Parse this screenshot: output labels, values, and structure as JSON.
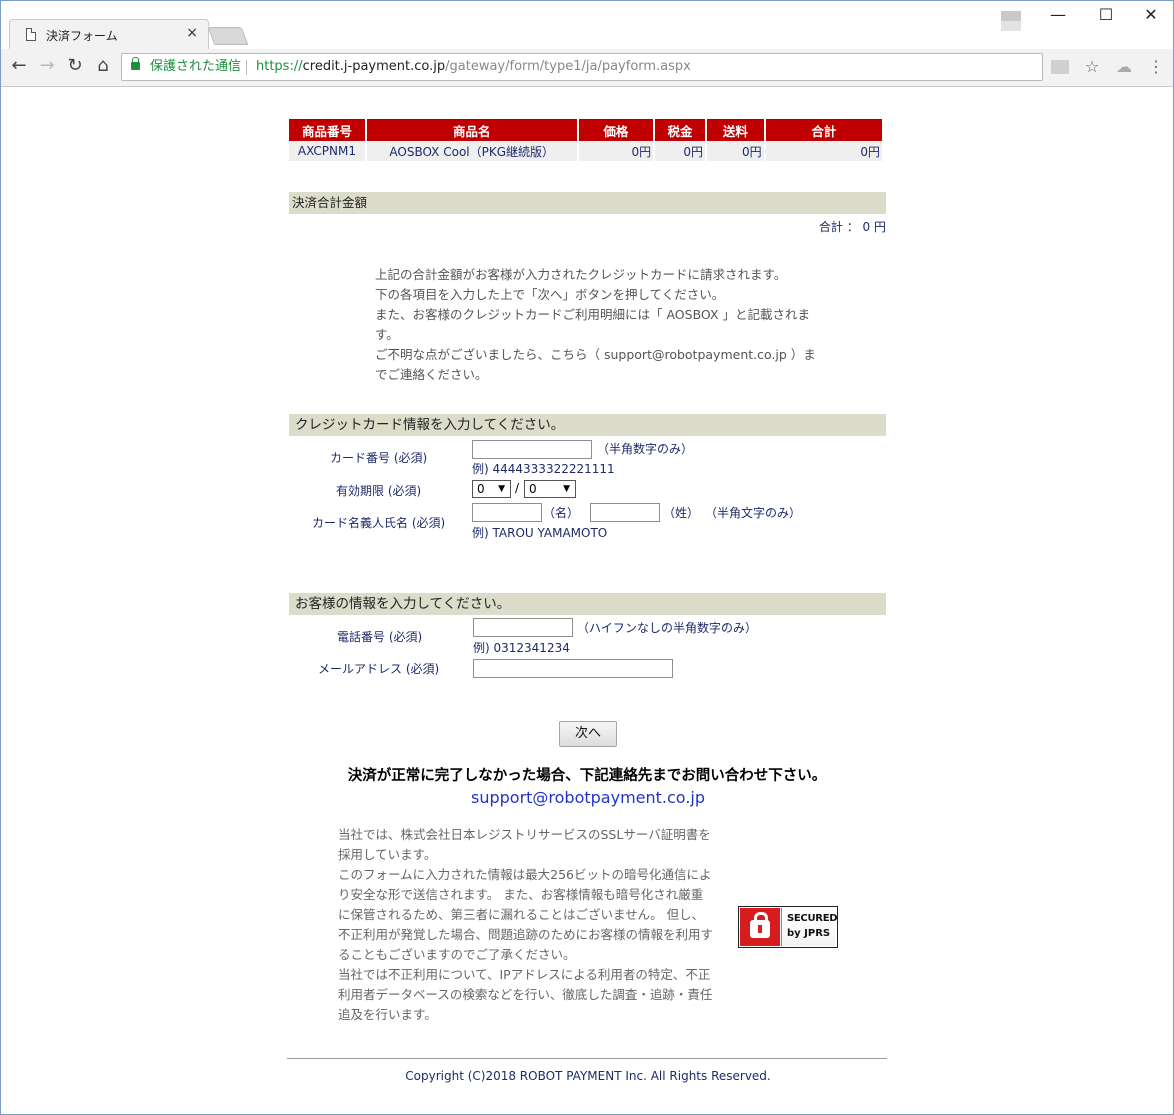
{
  "browser": {
    "tab_title": "決済フォーム",
    "tab_close": "×",
    "omnibox": {
      "secure_label": "保護された通信",
      "url_scheme": "https://",
      "url_host": "credit.j-payment.co.jp",
      "url_path": "/gateway/form/type1/ja/payform.aspx"
    },
    "window_controls": {
      "minimize": "—",
      "maximize": "☐",
      "close": "✕"
    },
    "nav": {
      "back": "←",
      "forward": "→",
      "reload": "↻",
      "home": "⌂"
    },
    "toolbar_icons": {
      "bookmark": "☆",
      "menu": "⋮",
      "cloud": "☁"
    }
  },
  "items_table": {
    "headers": [
      "商品番号",
      "商品名",
      "価格",
      "税金",
      "送料",
      "合計"
    ],
    "rows": [
      [
        "AXCPNM1",
        "AOSBOX Cool（PKG継続版）",
        "0円",
        "0円",
        "0円",
        "0円"
      ]
    ]
  },
  "payment_total": {
    "section_title": "決済合計金額",
    "total_text": "合計 ：  0  円"
  },
  "notice": {
    "lines": [
      "上記の合計金額がお客様が入力されたクレジットカードに請求されます。",
      "下の各項目を入力した上で「次へ」ボタンを押してください。",
      "また、お客様のクレジットカードご利用明細には「 AOSBOX 」と記載されま",
      "す。",
      "ご不明な点がございましたら、こちら（ support@robotpayment.co.jp ）ま",
      "でご連絡ください。"
    ]
  },
  "card_section": {
    "title": "クレジットカード情報を入力してください。",
    "card_number_label": "カード番号 (必須)",
    "card_number_hint": "（半角数字のみ）",
    "card_number_example": "例) 4444333322221111",
    "expiry_label": "有効期限 (必須)",
    "expiry_month": "0",
    "expiry_slash": "/",
    "expiry_year": "0",
    "name_label": "カード名義人氏名 (必須)",
    "first_name_suffix": "（名）",
    "last_name_suffix": "（姓）",
    "name_hint": "（半角文字のみ）",
    "name_example": "例) TAROU YAMAMOTO"
  },
  "customer_section": {
    "title": "お客様の情報を入力してください。",
    "phone_label": "電話番号 (必須)",
    "phone_hint": "（ハイフンなしの半角数字のみ）",
    "phone_example": "例) 0312341234",
    "email_label": "メールアドレス (必須)"
  },
  "next_button": "次へ",
  "contact": {
    "heading": "決済が正常に完了しなかった場合、下記連絡先までお問い合わせ下さい。",
    "email": "support@robotpayment.co.jp"
  },
  "ssl_info": {
    "lines": [
      "当社では、株式会社日本レジストリサービスのSSLサーバ証明書を",
      "採用しています。",
      "このフォームに入力された情報は最大256ビットの暗号化通信によ",
      "り安全な形で送信されます。 また、お客様情報も暗号化され厳重",
      "に保管されるため、第三者に漏れることはございません。 但し、",
      "不正利用が発覚した場合、問題追跡のためにお客様の情報を利用す",
      "ることもございますのでご了承ください。",
      "当社では不正利用について、IPアドレスによる利用者の特定、不正",
      "利用者データベースの検索などを行い、徹底した調査・追跡・責任",
      "追及を行います。"
    ],
    "seal_line1": "SECURED",
    "seal_line2": "by JPRS"
  },
  "footer": {
    "copyright": "Copyright (C)2018 ROBOT PAYMENT Inc. All Rights Reserved."
  }
}
